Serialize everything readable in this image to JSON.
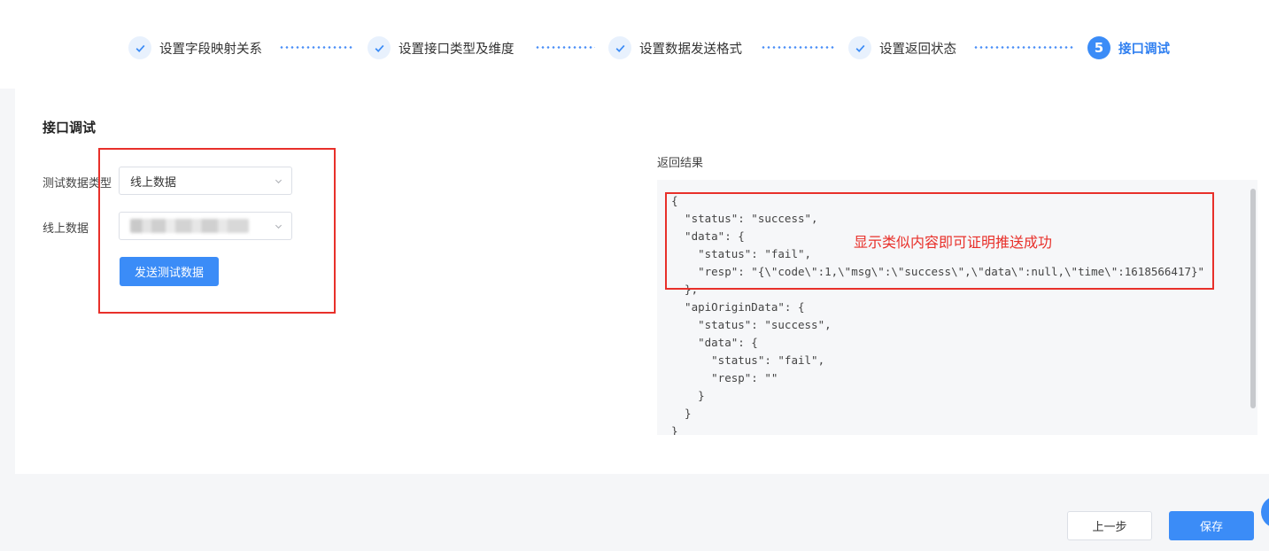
{
  "steps": [
    {
      "label": "设置字段映射关系",
      "state": "done"
    },
    {
      "label": "设置接口类型及维度",
      "state": "done"
    },
    {
      "label": "设置数据发送格式",
      "state": "done"
    },
    {
      "label": "设置返回状态",
      "state": "done"
    },
    {
      "number": "5",
      "label": "接口调试",
      "state": "active"
    }
  ],
  "form": {
    "section_title": "接口调试",
    "data_type_label": "测试数据类型",
    "data_type_value": "线上数据",
    "online_data_label": "线上数据",
    "send_button": "发送测试数据"
  },
  "result": {
    "label": "返回结果",
    "code_lines": [
      "{",
      "  \"status\": \"success\",",
      "  \"data\": {",
      "    \"status\": \"fail\",",
      "    \"resp\": \"{\\\"code\\\":1,\\\"msg\\\":\\\"success\\\",\\\"data\\\":null,\\\"time\\\":1618566417}\"",
      "  },",
      "  \"apiOriginData\": {",
      "    \"status\": \"success\",",
      "    \"data\": {",
      "      \"status\": \"fail\",",
      "      \"resp\": \"\"",
      "    }",
      "  }",
      "}"
    ]
  },
  "annotation": "显示类似内容即可证明推送成功",
  "footer": {
    "prev_button": "上一步",
    "save_button": "保存"
  },
  "colors": {
    "accent": "#3b8cf7",
    "annotation_red": "#e8302a"
  }
}
